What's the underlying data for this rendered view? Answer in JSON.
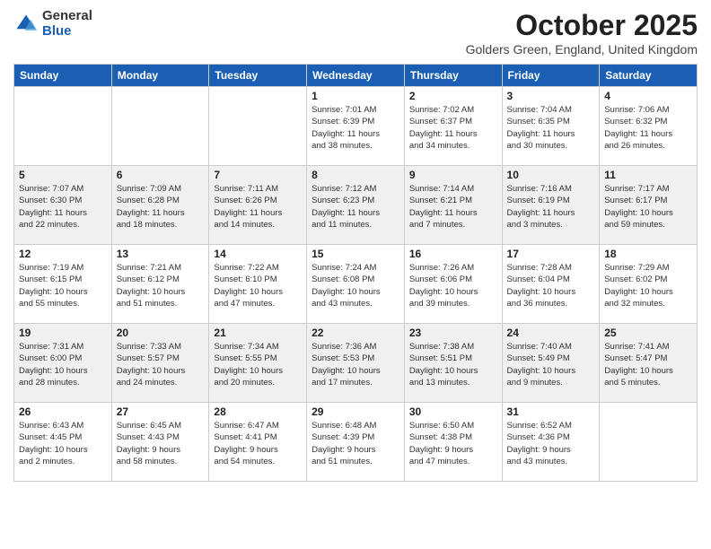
{
  "header": {
    "logo": {
      "general": "General",
      "blue": "Blue"
    },
    "title": "October 2025",
    "location": "Golders Green, England, United Kingdom"
  },
  "days_of_week": [
    "Sunday",
    "Monday",
    "Tuesday",
    "Wednesday",
    "Thursday",
    "Friday",
    "Saturday"
  ],
  "weeks": [
    [
      {
        "day": "",
        "info": ""
      },
      {
        "day": "",
        "info": ""
      },
      {
        "day": "",
        "info": ""
      },
      {
        "day": "1",
        "info": "Sunrise: 7:01 AM\nSunset: 6:39 PM\nDaylight: 11 hours\nand 38 minutes."
      },
      {
        "day": "2",
        "info": "Sunrise: 7:02 AM\nSunset: 6:37 PM\nDaylight: 11 hours\nand 34 minutes."
      },
      {
        "day": "3",
        "info": "Sunrise: 7:04 AM\nSunset: 6:35 PM\nDaylight: 11 hours\nand 30 minutes."
      },
      {
        "day": "4",
        "info": "Sunrise: 7:06 AM\nSunset: 6:32 PM\nDaylight: 11 hours\nand 26 minutes."
      }
    ],
    [
      {
        "day": "5",
        "info": "Sunrise: 7:07 AM\nSunset: 6:30 PM\nDaylight: 11 hours\nand 22 minutes."
      },
      {
        "day": "6",
        "info": "Sunrise: 7:09 AM\nSunset: 6:28 PM\nDaylight: 11 hours\nand 18 minutes."
      },
      {
        "day": "7",
        "info": "Sunrise: 7:11 AM\nSunset: 6:26 PM\nDaylight: 11 hours\nand 14 minutes."
      },
      {
        "day": "8",
        "info": "Sunrise: 7:12 AM\nSunset: 6:23 PM\nDaylight: 11 hours\nand 11 minutes."
      },
      {
        "day": "9",
        "info": "Sunrise: 7:14 AM\nSunset: 6:21 PM\nDaylight: 11 hours\nand 7 minutes."
      },
      {
        "day": "10",
        "info": "Sunrise: 7:16 AM\nSunset: 6:19 PM\nDaylight: 11 hours\nand 3 minutes."
      },
      {
        "day": "11",
        "info": "Sunrise: 7:17 AM\nSunset: 6:17 PM\nDaylight: 10 hours\nand 59 minutes."
      }
    ],
    [
      {
        "day": "12",
        "info": "Sunrise: 7:19 AM\nSunset: 6:15 PM\nDaylight: 10 hours\nand 55 minutes."
      },
      {
        "day": "13",
        "info": "Sunrise: 7:21 AM\nSunset: 6:12 PM\nDaylight: 10 hours\nand 51 minutes."
      },
      {
        "day": "14",
        "info": "Sunrise: 7:22 AM\nSunset: 6:10 PM\nDaylight: 10 hours\nand 47 minutes."
      },
      {
        "day": "15",
        "info": "Sunrise: 7:24 AM\nSunset: 6:08 PM\nDaylight: 10 hours\nand 43 minutes."
      },
      {
        "day": "16",
        "info": "Sunrise: 7:26 AM\nSunset: 6:06 PM\nDaylight: 10 hours\nand 39 minutes."
      },
      {
        "day": "17",
        "info": "Sunrise: 7:28 AM\nSunset: 6:04 PM\nDaylight: 10 hours\nand 36 minutes."
      },
      {
        "day": "18",
        "info": "Sunrise: 7:29 AM\nSunset: 6:02 PM\nDaylight: 10 hours\nand 32 minutes."
      }
    ],
    [
      {
        "day": "19",
        "info": "Sunrise: 7:31 AM\nSunset: 6:00 PM\nDaylight: 10 hours\nand 28 minutes."
      },
      {
        "day": "20",
        "info": "Sunrise: 7:33 AM\nSunset: 5:57 PM\nDaylight: 10 hours\nand 24 minutes."
      },
      {
        "day": "21",
        "info": "Sunrise: 7:34 AM\nSunset: 5:55 PM\nDaylight: 10 hours\nand 20 minutes."
      },
      {
        "day": "22",
        "info": "Sunrise: 7:36 AM\nSunset: 5:53 PM\nDaylight: 10 hours\nand 17 minutes."
      },
      {
        "day": "23",
        "info": "Sunrise: 7:38 AM\nSunset: 5:51 PM\nDaylight: 10 hours\nand 13 minutes."
      },
      {
        "day": "24",
        "info": "Sunrise: 7:40 AM\nSunset: 5:49 PM\nDaylight: 10 hours\nand 9 minutes."
      },
      {
        "day": "25",
        "info": "Sunrise: 7:41 AM\nSunset: 5:47 PM\nDaylight: 10 hours\nand 5 minutes."
      }
    ],
    [
      {
        "day": "26",
        "info": "Sunrise: 6:43 AM\nSunset: 4:45 PM\nDaylight: 10 hours\nand 2 minutes."
      },
      {
        "day": "27",
        "info": "Sunrise: 6:45 AM\nSunset: 4:43 PM\nDaylight: 9 hours\nand 58 minutes."
      },
      {
        "day": "28",
        "info": "Sunrise: 6:47 AM\nSunset: 4:41 PM\nDaylight: 9 hours\nand 54 minutes."
      },
      {
        "day": "29",
        "info": "Sunrise: 6:48 AM\nSunset: 4:39 PM\nDaylight: 9 hours\nand 51 minutes."
      },
      {
        "day": "30",
        "info": "Sunrise: 6:50 AM\nSunset: 4:38 PM\nDaylight: 9 hours\nand 47 minutes."
      },
      {
        "day": "31",
        "info": "Sunrise: 6:52 AM\nSunset: 4:36 PM\nDaylight: 9 hours\nand 43 minutes."
      },
      {
        "day": "",
        "info": ""
      }
    ]
  ]
}
